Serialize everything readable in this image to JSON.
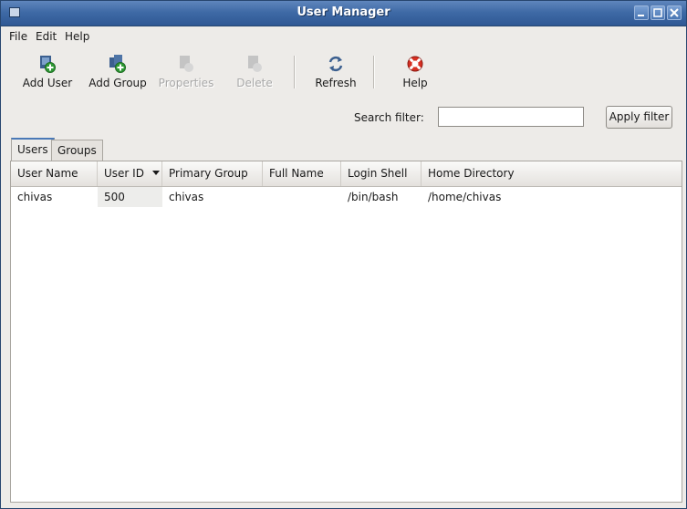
{
  "window": {
    "title": "User Manager",
    "controls": [
      "minimize",
      "maximize",
      "close"
    ]
  },
  "menu": [
    "File",
    "Edit",
    "Help"
  ],
  "toolbar": {
    "add_user": {
      "label": "Add User",
      "enabled": true,
      "icon": "add-user-icon"
    },
    "add_group": {
      "label": "Add Group",
      "enabled": true,
      "icon": "add-group-icon"
    },
    "properties": {
      "label": "Properties",
      "enabled": false,
      "icon": "properties-icon"
    },
    "delete": {
      "label": "Delete",
      "enabled": false,
      "icon": "delete-icon"
    },
    "refresh": {
      "label": "Refresh",
      "enabled": true,
      "icon": "refresh-icon"
    },
    "help": {
      "label": "Help",
      "enabled": true,
      "icon": "help-lifebuoy-icon"
    }
  },
  "filter": {
    "label": "Search filter:",
    "value": "",
    "apply_label": "Apply filter"
  },
  "tabs": [
    {
      "label": "Users",
      "active": true
    },
    {
      "label": "Groups",
      "active": false
    }
  ],
  "table": {
    "columns": [
      "User Name",
      "User ID",
      "Primary Group",
      "Full Name",
      "Login Shell",
      "Home Directory"
    ],
    "sort_column": "User ID",
    "rows": [
      [
        "chivas",
        "500",
        "chivas",
        "",
        "/bin/bash",
        "/home/chivas"
      ]
    ]
  },
  "colors": {
    "titlebar": "#3f6aa6",
    "window_bg": "#edebe8",
    "tab_accent": "#4a79b7"
  }
}
